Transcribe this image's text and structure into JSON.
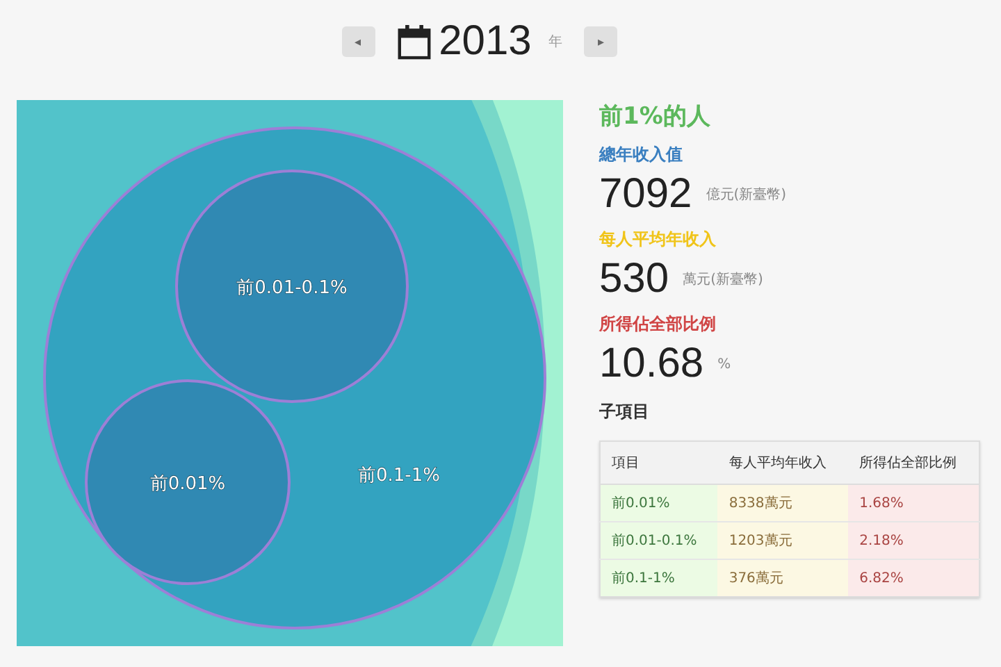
{
  "year_nav": {
    "prev": "◂",
    "year": "2013",
    "unit": "年",
    "next": "▸"
  },
  "bubbles": [
    {
      "label": "前0.01-0.1%"
    },
    {
      "label": "前0.01%"
    },
    {
      "label": "前0.1-1%"
    }
  ],
  "detail": {
    "title": "前1%的人",
    "stats": [
      {
        "label": "總年收入值",
        "color": "#3a7fc0",
        "value": "7092",
        "unit": "億元(新臺幣)"
      },
      {
        "label": "每人平均年收入",
        "color": "#f0c419",
        "value": "530",
        "unit": "萬元(新臺幣)"
      },
      {
        "label": "所得佔全部比例",
        "color": "#d04545",
        "value": "10.68",
        "unit": "%"
      }
    ],
    "sub_title": "子項目",
    "table": {
      "columns": [
        "項目",
        "每人平均年收入",
        "所得佔全部比例"
      ],
      "rows": [
        [
          "前0.01%",
          "8338萬元",
          "1.68%"
        ],
        [
          "前0.01-0.1%",
          "1203萬元",
          "2.18%"
        ],
        [
          "前0.1-1%",
          "376萬元",
          "6.82%"
        ]
      ]
    }
  }
}
